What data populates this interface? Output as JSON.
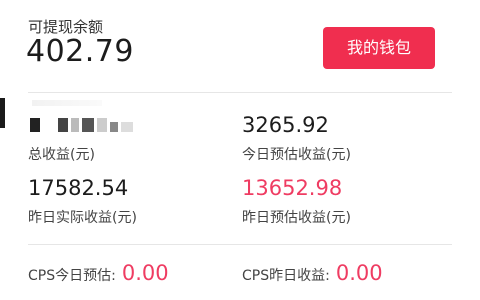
{
  "balance": {
    "label": "可提现余额",
    "value": "402.79"
  },
  "wallet_button": {
    "label": "我的钱包"
  },
  "stats": {
    "total": {
      "label": "总收益(元)"
    },
    "today_estimated": {
      "value": "3265.92",
      "label": "今日预估收益(元)"
    },
    "yesterday_actual": {
      "value": "17582.54",
      "label": "昨日实际收益(元)"
    },
    "yesterday_estimated": {
      "value": "13652.98",
      "label": "昨日预估收益(元)"
    }
  },
  "cps": {
    "today": {
      "label": "CPS今日预估:",
      "value": "0.00"
    },
    "yesterday": {
      "label": "CPS昨日收益:",
      "value": "0.00"
    }
  },
  "colors": {
    "accent": "#f02e4f",
    "highlight_value": "#ef3c62"
  }
}
